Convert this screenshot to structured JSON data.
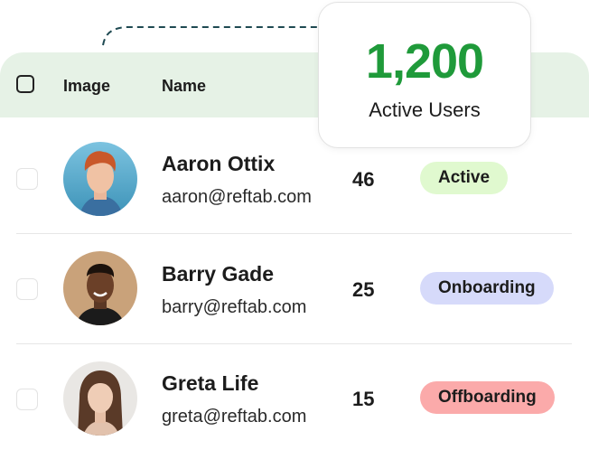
{
  "table": {
    "header": {
      "image_label": "Image",
      "name_label": "Name"
    },
    "rows": [
      {
        "name": "Aaron Ottix",
        "email": "aaron@reftab.com",
        "count": "46",
        "status": "Active",
        "status_color": "#e0f9cf"
      },
      {
        "name": "Barry Gade",
        "email": "barry@reftab.com",
        "count": "25",
        "status": "Onboarding",
        "status_color": "#d6dafa"
      },
      {
        "name": "Greta Life",
        "email": "greta@reftab.com",
        "count": "15",
        "status": "Offboarding",
        "status_color": "#fbaaaa"
      }
    ]
  },
  "stat_card": {
    "value": "1,200",
    "label": "Active Users",
    "value_color": "#1f9a3a"
  },
  "colors": {
    "header_bg": "#e6f2e6",
    "dashed_line": "#1f4a52"
  }
}
